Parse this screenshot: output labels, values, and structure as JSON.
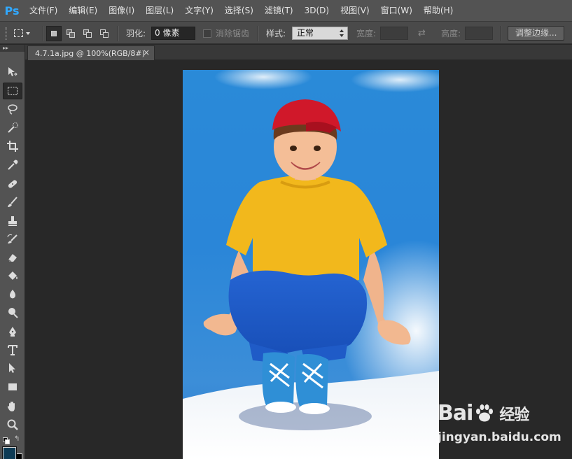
{
  "app": {
    "logo": "Ps",
    "menu": [
      "文件(F)",
      "编辑(E)",
      "图像(I)",
      "图层(L)",
      "文字(Y)",
      "选择(S)",
      "滤镜(T)",
      "3D(D)",
      "视图(V)",
      "窗口(W)",
      "帮助(H)"
    ]
  },
  "options": {
    "feather_label": "羽化:",
    "feather_value": "0 像素",
    "antialias_label": "消除锯齿",
    "style_label": "样式:",
    "style_value": "正常",
    "width_label": "宽度:",
    "width_value": "",
    "height_label": "高度:",
    "height_value": "",
    "refine_edge": "调整边缘..."
  },
  "document": {
    "tab_title": "4.7.1a.jpg @ 100%(RGB/8#)",
    "close_glyph": "×"
  },
  "toolbox": {
    "tools": [
      "move-tool",
      "marquee-tool",
      "lasso-tool",
      "quick-select-tool",
      "crop-tool",
      "eyedropper-tool",
      "healing-brush-tool",
      "brush-tool",
      "clone-stamp-tool",
      "history-brush-tool",
      "eraser-tool",
      "paint-bucket-tool",
      "blur-tool",
      "dodge-tool",
      "pen-tool",
      "type-tool",
      "path-select-tool",
      "shape-tool",
      "hand-tool",
      "zoom-tool"
    ],
    "active_tool": "marquee-tool",
    "foreground_color": "#0d3b55",
    "background_color": "#000000"
  },
  "watermark": {
    "brand_left": "Bai",
    "brand_right": "经验",
    "url": "jingyan.baidu.com"
  },
  "colors": {
    "accent": "#31a8ff",
    "sky": "#2a86d8",
    "cap": "#d0182a",
    "shirt": "#f2b81c",
    "jeans": "#1f5bc7"
  }
}
